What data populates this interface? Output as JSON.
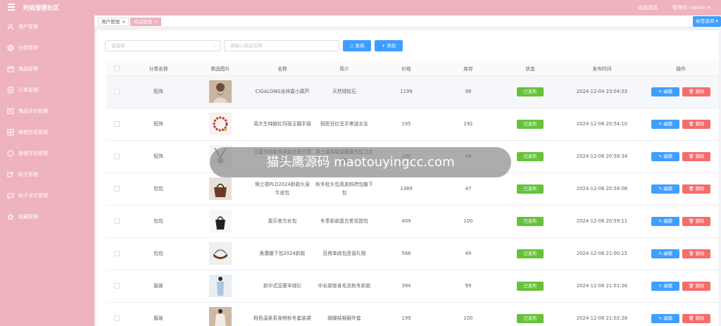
{
  "header": {
    "app_title": "时尚穿搭社区",
    "back_home": "返回首页",
    "admin_label": "管理员: admin ▾"
  },
  "sidebar": {
    "items": [
      {
        "label": "用户管理",
        "icon": "user-icon"
      },
      {
        "label": "分类管理",
        "icon": "globe-icon"
      },
      {
        "label": "商品管理",
        "icon": "box-icon"
      },
      {
        "label": "订单管理",
        "icon": "document-icon"
      },
      {
        "label": "商品评论管理",
        "icon": "comment-list-icon"
      },
      {
        "label": "穿搭信息管理",
        "icon": "grid-icon"
      },
      {
        "label": "穿搭评论管理",
        "icon": "chat-icon"
      },
      {
        "label": "帖子管理",
        "icon": "post-icon"
      },
      {
        "label": "帖子评论管理",
        "icon": "message-icon"
      },
      {
        "label": "收藏管理",
        "icon": "star-icon"
      }
    ]
  },
  "tabs": [
    {
      "label": "用户管理",
      "close": "×",
      "active": false
    },
    {
      "label": "商品管理",
      "close": "×",
      "active": true
    }
  ],
  "tab_options": "标签选项 ▾",
  "toolbar": {
    "select_placeholder": "请选择",
    "select_caret": "⌄",
    "search_placeholder": "请输入商品名称",
    "query_label": "○ 查询",
    "add_label": "+ 添加"
  },
  "table": {
    "headers": [
      "分类名称",
      "商品图片",
      "名称",
      "简介",
      "价格",
      "库存",
      "状态",
      "发布时间",
      "操作"
    ],
    "edit_label": "✎ 编辑",
    "delete_label": "🗑 删除",
    "rows": [
      {
        "category": "配饰",
        "name": "CIGALONG龙祥嘉小葫芦",
        "intro": "天然绿松石",
        "price": "1199",
        "stock": "98",
        "status": "已发布",
        "time": "2024-12-04 23:04:03"
      },
      {
        "category": "配饰",
        "name": "周大生纯银红玛瑙玉髓手链",
        "intro": "相思豆红豆手串送女友",
        "price": "195",
        "stock": "192",
        "status": "已发布",
        "time": "2024-12-06 20:54:10"
      },
      {
        "category": "配饰",
        "name": "王嘉尔同款双层鼓花里巴项链",
        "intro": "男士潮高级感叠戴吊坠卫衣链",
        "price": "100",
        "stock": "49",
        "status": "已发布",
        "time": "2024-12-06 20:56:34"
      },
      {
        "category": "包包",
        "name": "保兰德PLD2024新款头层牛皮包",
        "intro": "秋冬枕头包真皮斜挎包腋下包",
        "price": "1389",
        "stock": "47",
        "status": "已发布",
        "time": "2024-12-06 20:58:06"
      },
      {
        "category": "包包",
        "name": "斐乐官方女包",
        "intro": "冬季新款复古老花提包",
        "price": "409",
        "stock": "100",
        "status": "已发布",
        "time": "2024-12-06 20:59:11"
      },
      {
        "category": "包包",
        "name": "奥康腋下包2024新款",
        "intro": "百搭单肩包圣诞礼物",
        "price": "566",
        "stock": "49",
        "status": "已发布",
        "time": "2024-12-06 21:00:15"
      },
      {
        "category": "服装",
        "name": "新中式显瘦羊绒衫",
        "intro": "中长款修身毛衣秋冬新款",
        "price": "394",
        "stock": "99",
        "status": "已发布",
        "time": "2024-12-06 21:01:26"
      },
      {
        "category": "服装",
        "name": "粉色温柔系穿搭秋冬套装裙",
        "intro": "蝴蝶结棉服外套",
        "price": "199",
        "stock": "100",
        "status": "已发布",
        "time": "2024-12-06 21:02:28"
      }
    ]
  },
  "watermark_text": "猫头鹰源码 maotouyingcc.com",
  "colors": {
    "sidebar": "#eeb3be",
    "primary": "#409eff",
    "success": "#67c23a",
    "danger": "#f56c6c"
  }
}
